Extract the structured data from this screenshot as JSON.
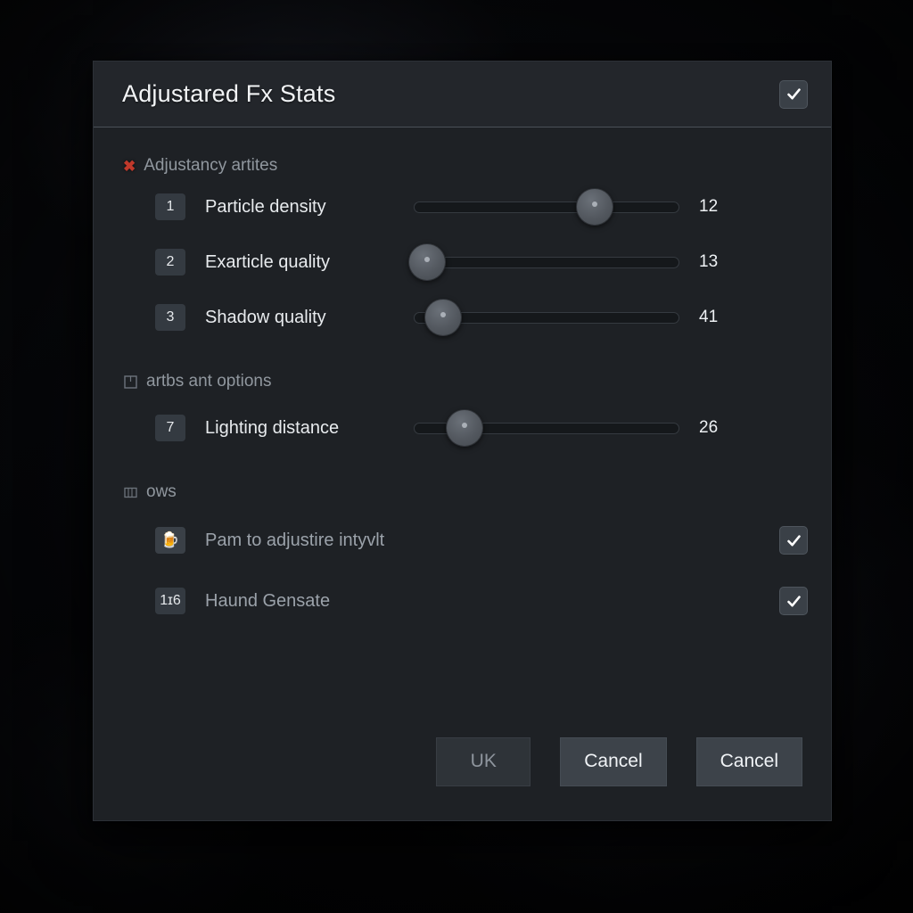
{
  "window": {
    "title": "Adjustared Fx Stats",
    "title_checkbox": {
      "name": "title-checkbox",
      "checked": true
    }
  },
  "sections": [
    {
      "icon": "x-icon",
      "label": "Adjustancy artites",
      "rows": [
        {
          "badge": "1",
          "label": "Particle density",
          "value": "12",
          "percent": 68
        },
        {
          "badge": "2",
          "label": "Exarticle quality",
          "value": "13",
          "percent": 5
        },
        {
          "badge": "3",
          "label": "Shadow quality",
          "value": "41",
          "percent": 11
        }
      ]
    },
    {
      "icon": "square-outline-icon",
      "label": "artbs ant options",
      "rows": [
        {
          "badge": "7",
          "label": "Lighting distance",
          "value": "26",
          "percent": 19
        }
      ]
    },
    {
      "icon": "grid-icon",
      "label": "ows",
      "rows": [
        {
          "badge": "🍺",
          "label": "Pam to adjustire intyvlt",
          "checked": true
        },
        {
          "badge": "1ɪ6",
          "label": "Haund Gensate",
          "checked": true
        }
      ]
    }
  ],
  "footer": {
    "buttons": [
      {
        "label": "UK",
        "style": "muted"
      },
      {
        "label": "Cancel",
        "style": "normal"
      },
      {
        "label": "Cancel",
        "style": "normal"
      }
    ]
  },
  "colors": {
    "dialog_bg": "#1e2125",
    "titlebar_bg": "#23262b",
    "accent_red": "#c0392b",
    "text_primary": "#e8ebee",
    "text_muted": "#9aa1a9"
  }
}
